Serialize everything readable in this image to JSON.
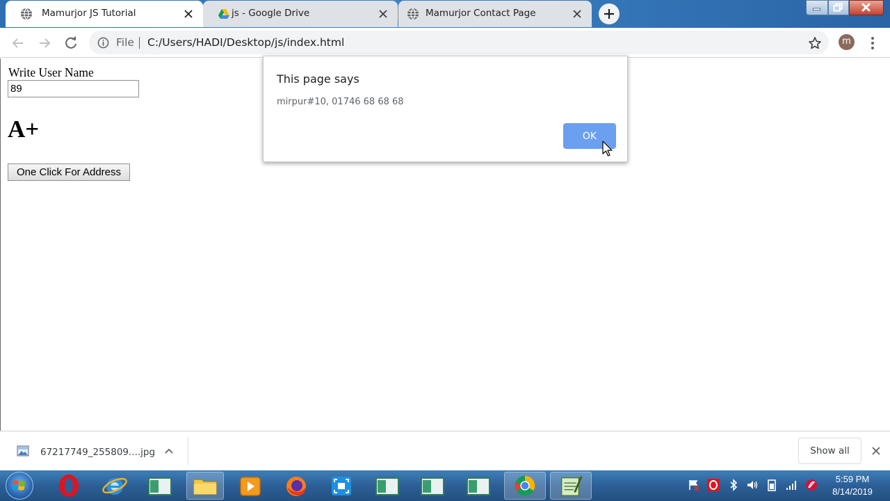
{
  "browser": {
    "tabs": [
      {
        "title": "Mamurjor JS Tutorial",
        "active": true,
        "favicon": "globe-icon"
      },
      {
        "title": "js - Google Drive",
        "active": false,
        "favicon": "google-drive-icon"
      },
      {
        "title": "Mamurjor Contact Page",
        "active": false,
        "favicon": "globe-icon"
      }
    ],
    "omnibox": {
      "scheme_label": "File",
      "url": "C:/Users/HADI/Desktop/js/index.html"
    },
    "profile_initial": "m"
  },
  "page": {
    "username_label": "Write User Name",
    "username_value": "89",
    "grade": "A+",
    "address_button": "One Click For Address"
  },
  "dialog": {
    "title": "This page says",
    "message": "mirpur#10, 01746 68 68 68",
    "ok_label": "OK"
  },
  "downloads": {
    "file_name": "67217749_255809....jpg",
    "show_all": "Show all"
  },
  "taskbar": {
    "time": "5:59 PM",
    "date": "8/14/2019",
    "apps": [
      "opera",
      "internet-explorer",
      "window",
      "file-explorer",
      "media-player",
      "firefox",
      "snipping-tool",
      "window",
      "window",
      "window",
      "chrome",
      "notepad"
    ]
  },
  "colors": {
    "accent": "#6b9ff0",
    "tab_inactive": "#dee1e6",
    "titlebar": "#3b83c4"
  }
}
